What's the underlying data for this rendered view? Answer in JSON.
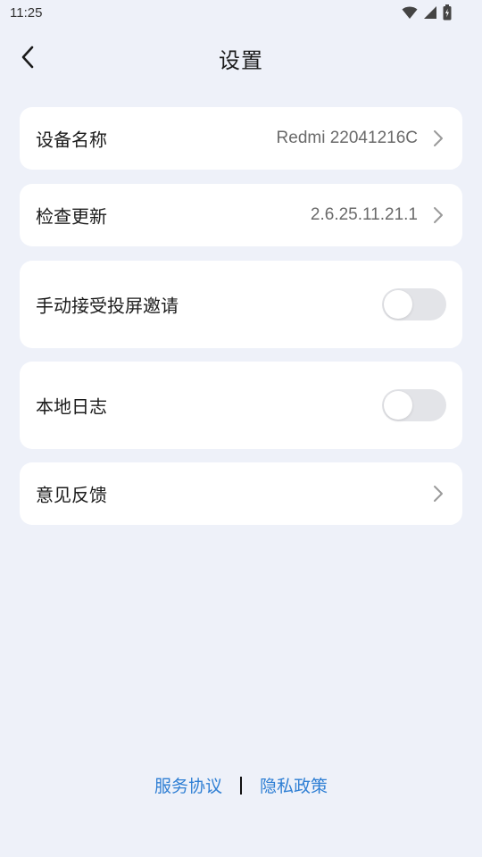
{
  "status_bar": {
    "time": "11:25"
  },
  "header": {
    "title": "设置"
  },
  "settings": {
    "device_name": {
      "label": "设备名称",
      "value": "Redmi 22041216C"
    },
    "check_update": {
      "label": "检查更新",
      "value": "2.6.25.11.21.1"
    },
    "manual_accept": {
      "label": "手动接受投屏邀请",
      "enabled": false
    },
    "local_log": {
      "label": "本地日志",
      "enabled": false
    },
    "feedback": {
      "label": "意见反馈"
    }
  },
  "footer": {
    "service_agreement": "服务协议",
    "privacy_policy": "隐私政策"
  },
  "colors": {
    "background": "#eef1f9",
    "card": "#ffffff",
    "link": "#2f7fd4",
    "toggle_off": "#e3e4e8"
  }
}
